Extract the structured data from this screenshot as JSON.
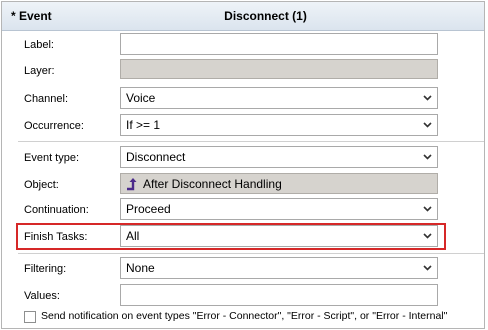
{
  "header": {
    "section": "* Event",
    "title": "Disconnect (1)"
  },
  "fields": {
    "label": {
      "label": "Label:",
      "value": ""
    },
    "layer": {
      "label": "Layer:",
      "value": ""
    },
    "channel": {
      "label": "Channel:",
      "value": "Voice"
    },
    "occurrence": {
      "label": "Occurrence:",
      "value": "If >= 1"
    },
    "event_type": {
      "label": "Event type:",
      "value": "Disconnect"
    },
    "object": {
      "label": "Object:",
      "value": "After Disconnect Handling"
    },
    "continuation": {
      "label": "Continuation:",
      "value": "Proceed"
    },
    "finish_tasks": {
      "label": "Finish Tasks:",
      "value": "All"
    },
    "filtering": {
      "label": "Filtering:",
      "value": "None"
    },
    "values": {
      "label": "Values:",
      "value": ""
    }
  },
  "notification": {
    "checked": false,
    "label": "Send notification on event types \"Error - Connector\", \"Error - Script\", or \"Error - Internal\""
  },
  "colors": {
    "highlight": "#d62828",
    "header_bg": "#dbe4ee",
    "object_icon": "#4b2a8a"
  }
}
